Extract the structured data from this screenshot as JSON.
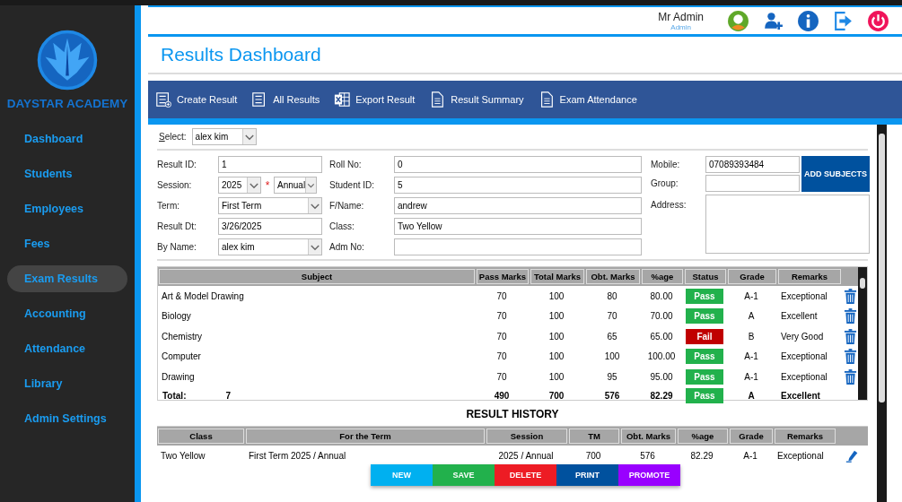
{
  "sidebar": {
    "brand": "DAYSTAR ACADEMY",
    "items": [
      {
        "label": "Dashboard",
        "selected": false
      },
      {
        "label": "Students",
        "selected": false
      },
      {
        "label": "Employees",
        "selected": false
      },
      {
        "label": "Fees",
        "selected": false
      },
      {
        "label": "Exam Results",
        "selected": true
      },
      {
        "label": "Accounting",
        "selected": false
      },
      {
        "label": "Attendance",
        "selected": false
      },
      {
        "label": "Library",
        "selected": false
      },
      {
        "label": "Admin Settings",
        "selected": false
      }
    ]
  },
  "user": {
    "name": "Mr Admin",
    "role": "Admin"
  },
  "title": "Results Dashboard",
  "toolbar": [
    {
      "label": "Create Result",
      "kind": "create"
    },
    {
      "label": "All Results",
      "kind": "list"
    },
    {
      "label": "Export Result",
      "kind": "excel"
    },
    {
      "label": "Result Summary",
      "kind": "summary"
    },
    {
      "label": "Exam Attendance",
      "kind": "attendance"
    }
  ],
  "select": {
    "label": "Select:",
    "value": "alex kim"
  },
  "form": {
    "result_id": {
      "label": "Result ID:",
      "value": "1"
    },
    "session": {
      "label": "Session:",
      "value": "2025",
      "required_mark": "*",
      "period": "Annual"
    },
    "term": {
      "label": "Term:",
      "value": "First Term"
    },
    "result_dt": {
      "label": "Result Dt:",
      "value": "3/26/2025"
    },
    "by_name": {
      "label": "By Name:",
      "value": "alex kim"
    },
    "roll_no": {
      "label": "Roll No:",
      "value": "0"
    },
    "student_id": {
      "label": "Student ID:",
      "value": "5"
    },
    "f_name": {
      "label": "F/Name:",
      "value": "andrew"
    },
    "class": {
      "label": "Class:",
      "value": "Two Yellow"
    },
    "adm_no": {
      "label": "Adm No:"
    },
    "mobile": {
      "label": "Mobile:",
      "value": "07089393484"
    },
    "group": {
      "label": "Group:"
    },
    "address": {
      "label": "Address:"
    },
    "add_subjects": "ADD SUBJECTS"
  },
  "subjects": {
    "columns": [
      "Subject",
      "Pass Marks",
      "Total Marks",
      "Obt. Marks",
      "%age",
      "Status",
      "Grade",
      "Remarks"
    ],
    "rows": [
      {
        "subject": "Art & Model Drawing",
        "pass_marks": "70",
        "total_marks": "100",
        "obt_marks": "80",
        "percent": "80.00",
        "status": "Pass",
        "passed": true,
        "grade": "A-1",
        "remarks": "Exceptional"
      },
      {
        "subject": "Biology",
        "pass_marks": "70",
        "total_marks": "100",
        "obt_marks": "70",
        "percent": "70.00",
        "status": "Pass",
        "passed": true,
        "grade": "A",
        "remarks": "Excellent"
      },
      {
        "subject": "Chemistry",
        "pass_marks": "70",
        "total_marks": "100",
        "obt_marks": "65",
        "percent": "65.00",
        "status": "Fail",
        "passed": false,
        "grade": "B",
        "remarks": "Very Good"
      },
      {
        "subject": "Computer",
        "pass_marks": "70",
        "total_marks": "100",
        "obt_marks": "100",
        "percent": "100.00",
        "status": "Pass",
        "passed": true,
        "grade": "A-1",
        "remarks": "Exceptional"
      },
      {
        "subject": "Drawing",
        "pass_marks": "70",
        "total_marks": "100",
        "obt_marks": "95",
        "percent": "95.00",
        "status": "Pass",
        "passed": true,
        "grade": "A-1",
        "remarks": "Exceptional"
      }
    ],
    "total": {
      "label": "Total:",
      "count": "7",
      "pass_marks": "490",
      "total_marks": "700",
      "obt_marks": "576",
      "percent": "82.29",
      "status": "Pass",
      "passed": true,
      "grade": "A",
      "remarks": "Excellent"
    }
  },
  "history": {
    "title": "RESULT HISTORY",
    "columns": [
      "Class",
      "For the Term",
      "Session",
      "TM",
      "Obt. Marks",
      "%age",
      "Grade",
      "Remarks"
    ],
    "rows": [
      {
        "class": "Two Yellow",
        "term": "First Term 2025 / Annual",
        "session": "2025 / Annual",
        "tm": "700",
        "obt_marks": "576",
        "percent": "82.29",
        "grade": "A-1",
        "remarks": "Exceptional"
      }
    ]
  },
  "actions": [
    {
      "label": "NEW",
      "color": "#00b0f0"
    },
    {
      "label": "SAVE",
      "color": "#22b14c"
    },
    {
      "label": "DELETE",
      "color": "#ed1c24"
    },
    {
      "label": "PRINT",
      "color": "#00519e"
    },
    {
      "label": "PROMOTE",
      "color": "#9900ff"
    }
  ]
}
